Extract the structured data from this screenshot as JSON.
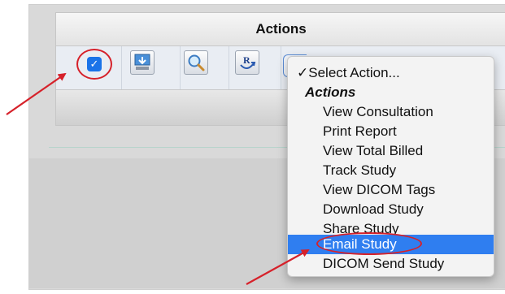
{
  "table": {
    "header": "Actions"
  },
  "row": {
    "checkbox_checked": true,
    "checkbox_glyph": "✓",
    "icons": [
      "download-icon",
      "search-icon",
      "report-icon"
    ]
  },
  "dropdown": {
    "selected": "✓Select Action...",
    "group_label": "Actions",
    "items": [
      "View Consultation",
      "Print Report",
      "View Total Billed",
      "Track Study",
      "View DICOM Tags",
      "Download Study",
      "Share Study",
      "Email Study",
      "DICOM Send Study"
    ],
    "highlighted_item": "Email Study"
  },
  "colors": {
    "highlight": "#2f7ef0",
    "annotation": "#d6212a",
    "checkbox": "#1a73e8"
  }
}
